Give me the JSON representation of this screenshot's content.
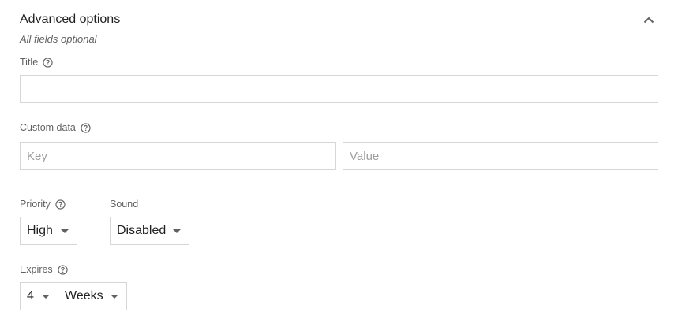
{
  "section": {
    "title": "Advanced options",
    "subtitle": "All fields optional"
  },
  "fields": {
    "title_label": "Title",
    "title_value": "",
    "custom_data_label": "Custom data",
    "key_placeholder": "Key",
    "value_placeholder": "Value",
    "priority_label": "Priority",
    "priority_value": "High",
    "sound_label": "Sound",
    "sound_value": "Disabled",
    "expires_label": "Expires",
    "expires_amount": "4",
    "expires_unit": "Weeks"
  },
  "icons": {
    "collapse": "chevron-up-icon",
    "help": "help-circle-icon",
    "dropdown": "caret-down-icon"
  },
  "colors": {
    "text": "#212121",
    "muted": "#616161",
    "border": "#d6d6d6",
    "placeholder": "#9e9e9e"
  }
}
